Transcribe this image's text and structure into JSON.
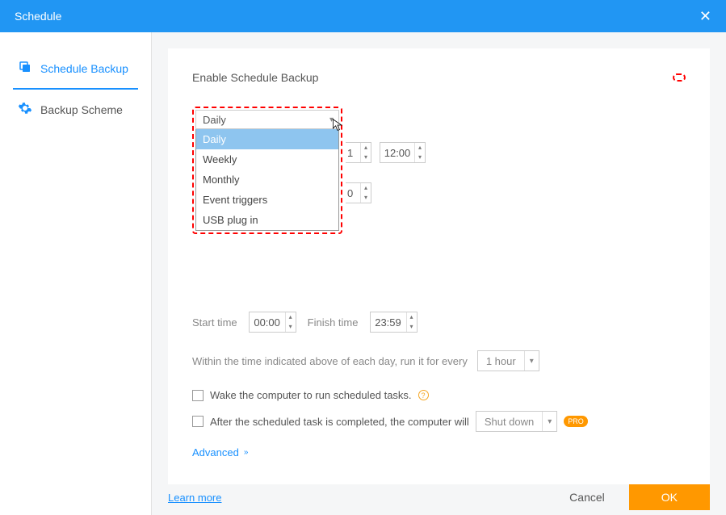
{
  "title": "Schedule",
  "sidebar": {
    "items": [
      {
        "label": "Schedule Backup"
      },
      {
        "label": "Backup Scheme"
      }
    ]
  },
  "panel": {
    "enable_label": "Enable Schedule Backup",
    "toggle_on": true,
    "frequency_value": "Daily",
    "frequency_options": [
      "Daily",
      "Weekly",
      "Monthly",
      "Event triggers",
      "USB plug in"
    ],
    "peek_value_row1a_suffix": "1",
    "peek_value_row1b": "12:00",
    "peek_value_row2_suffix": "0",
    "start_label": "Start time",
    "start_value": "00:00",
    "finish_label": "Finish time",
    "finish_value": "23:59",
    "interval_label": "Within the time indicated above of each day, run it for every",
    "interval_value": "1 hour",
    "wake_label": "Wake the computer to run scheduled tasks.",
    "after_label": "After the scheduled task is completed, the computer will",
    "after_value": "Shut down",
    "pro_badge": "PRO",
    "advanced_label": "Advanced"
  },
  "footer": {
    "learn_more": "Learn more",
    "cancel": "Cancel",
    "ok": "OK"
  }
}
